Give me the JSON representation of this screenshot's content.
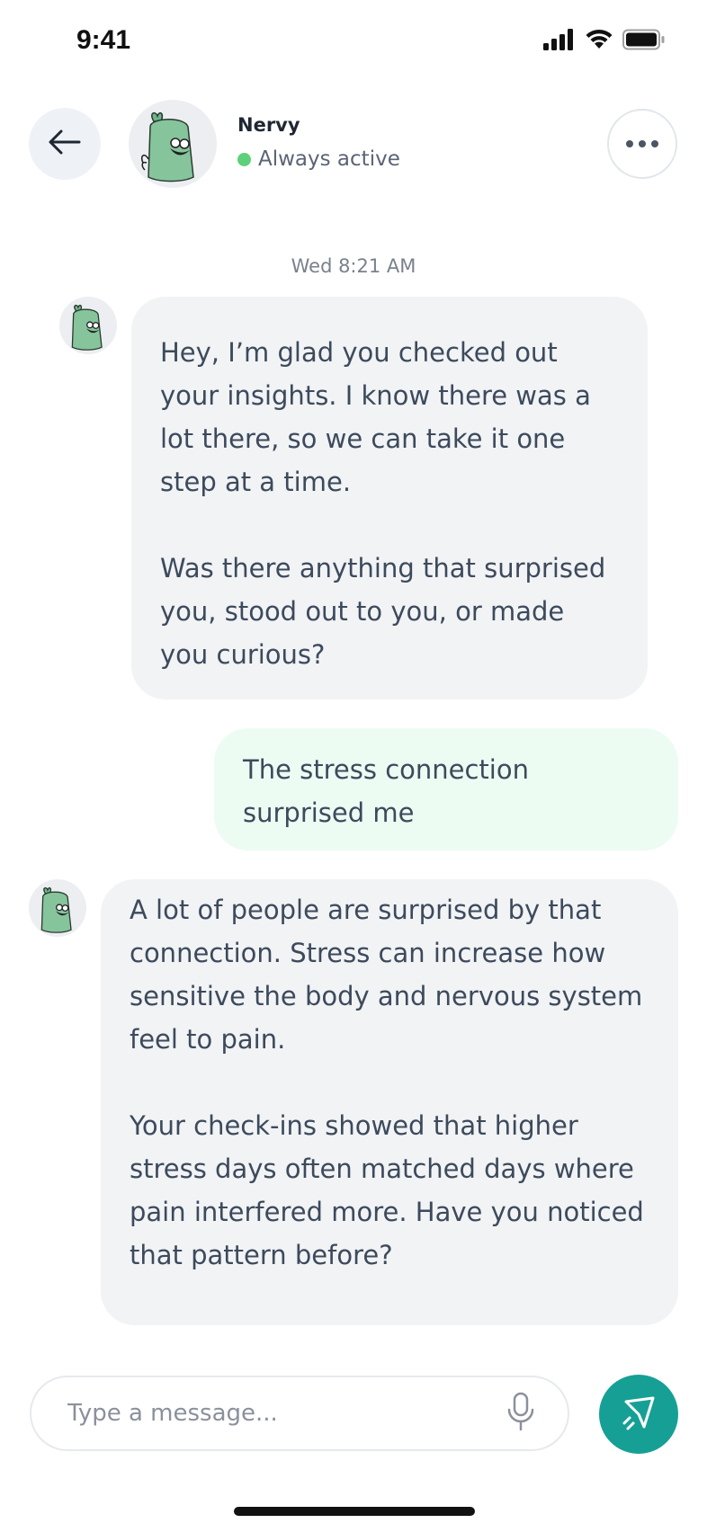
{
  "status_bar": {
    "time": "9:41",
    "icons": [
      "cellular-signal-icon",
      "wifi-icon",
      "battery-icon"
    ]
  },
  "header": {
    "back_icon": "arrow-left-icon",
    "name": "Nervy",
    "status": "Always active",
    "status_color": "#5ed07a",
    "more_icon": "more-horizontal-icon"
  },
  "conversation": {
    "timestamp": "Wed 8:21 AM",
    "messages": [
      {
        "sender": "bot",
        "text": "Hey, I’m glad you checked out your insights. I know there was a lot there, so we can take it one step at a time.\n\nWas there anything that surprised you, stood out to you, or made you curious?"
      },
      {
        "sender": "user",
        "text": "The stress connection surprised me"
      },
      {
        "sender": "bot",
        "text": "A lot of people are surprised by that connection. Stress can increase how sensitive the body and nervous system feel to pain.\n\nYour check-ins showed that higher stress days often matched days where pain interfered more. Have you noticed that pattern before?"
      }
    ]
  },
  "composer": {
    "placeholder": "Type a message...",
    "value": "",
    "mic_icon": "microphone-icon",
    "send_icon": "send-icon"
  },
  "colors": {
    "accent": "#16a095",
    "bot_bubble": "#f1f3f5",
    "user_bubble": "#edfcf3",
    "text": "#3d4a5c"
  }
}
